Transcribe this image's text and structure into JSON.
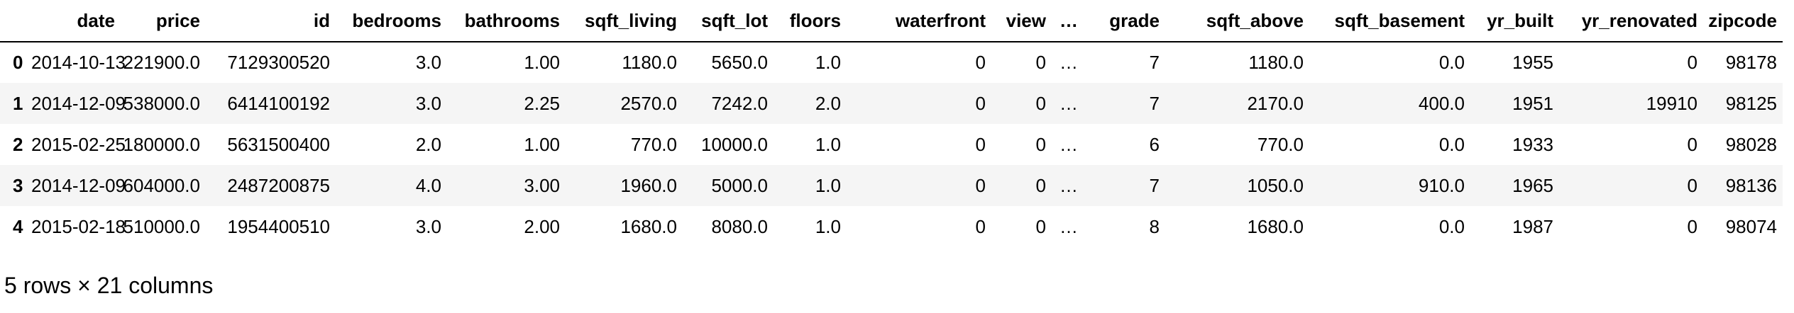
{
  "table": {
    "columns": [
      "date",
      "price",
      "id",
      "bedrooms",
      "bathrooms",
      "sqft_living",
      "sqft_lot",
      "floors",
      "waterfront",
      "view",
      "…",
      "grade",
      "sqft_above",
      "sqft_basement",
      "yr_built",
      "yr_renovated",
      "zipcode"
    ],
    "rows": [
      {
        "index": "0",
        "cells": [
          "2014-10-13",
          "221900.0",
          "7129300520",
          "3.0",
          "1.00",
          "1180.0",
          "5650.0",
          "1.0",
          "0",
          "0",
          "…",
          "7",
          "1180.0",
          "0.0",
          "1955",
          "0",
          "98178"
        ]
      },
      {
        "index": "1",
        "cells": [
          "2014-12-09",
          "538000.0",
          "6414100192",
          "3.0",
          "2.25",
          "2570.0",
          "7242.0",
          "2.0",
          "0",
          "0",
          "…",
          "7",
          "2170.0",
          "400.0",
          "1951",
          "19910",
          "98125"
        ]
      },
      {
        "index": "2",
        "cells": [
          "2015-02-25",
          "180000.0",
          "5631500400",
          "2.0",
          "1.00",
          "770.0",
          "10000.0",
          "1.0",
          "0",
          "0",
          "…",
          "6",
          "770.0",
          "0.0",
          "1933",
          "0",
          "98028"
        ]
      },
      {
        "index": "3",
        "cells": [
          "2014-12-09",
          "604000.0",
          "2487200875",
          "4.0",
          "3.00",
          "1960.0",
          "5000.0",
          "1.0",
          "0",
          "0",
          "…",
          "7",
          "1050.0",
          "910.0",
          "1965",
          "0",
          "98136"
        ]
      },
      {
        "index": "4",
        "cells": [
          "2015-02-18",
          "510000.0",
          "1954400510",
          "3.0",
          "2.00",
          "1680.0",
          "8080.0",
          "1.0",
          "0",
          "0",
          "…",
          "8",
          "1680.0",
          "0.0",
          "1987",
          "0",
          "98074"
        ]
      }
    ]
  },
  "shape_note": "5 rows × 21 columns"
}
